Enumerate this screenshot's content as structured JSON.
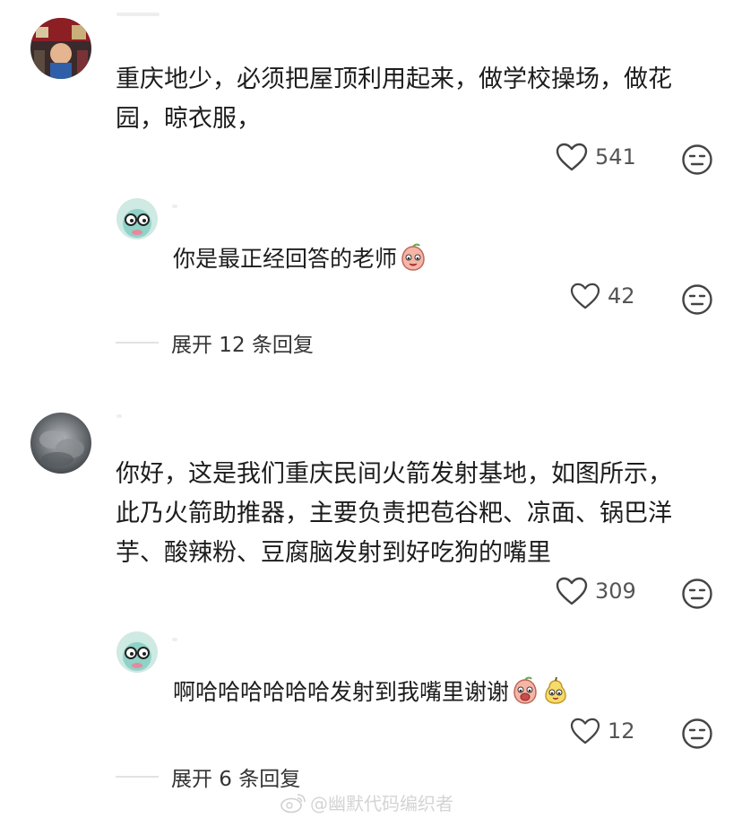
{
  "comments": [
    {
      "text_lines": [
        "重庆地少，必须把屋顶利用起来，做学校操场，做花",
        "园，晾衣服，"
      ],
      "likes": "541",
      "reply": {
        "text": "你是最正经回答的老师",
        "likes": "42"
      },
      "expand_text": "展开 12 条回复"
    },
    {
      "text_lines": [
        "你好，这是我们重庆民间火箭发射基地，如图所示，",
        "此乃火箭助推器，主要负责把苞谷粑、凉面、锅巴洋",
        "芋、酸辣粉、豆腐脑发射到好吃狗的嘴里"
      ],
      "likes": "309",
      "reply": {
        "text": "啊哈哈哈哈哈哈发射到我嘴里谢谢",
        "likes": "12"
      },
      "expand_text": "展开 6 条回复"
    }
  ],
  "watermark": "@幽默代码编织者",
  "icons": {
    "like": "heart-outline-icon",
    "dislike": "neutral-face-icon"
  }
}
